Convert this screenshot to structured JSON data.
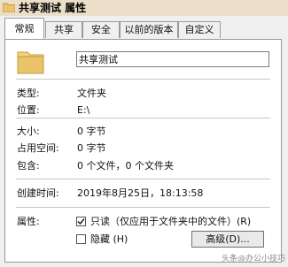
{
  "window": {
    "title": "共享测试 属性"
  },
  "tabs": [
    {
      "label": "常规",
      "active": true
    },
    {
      "label": "共享"
    },
    {
      "label": "安全"
    },
    {
      "label": "以前的版本"
    },
    {
      "label": "自定义"
    }
  ],
  "general": {
    "folder_name": "共享测试",
    "type_label": "类型:",
    "type_value": "文件夹",
    "location_label": "位置:",
    "location_value": "E:\\",
    "size_label": "大小:",
    "size_value": "0 字节",
    "disk_size_label": "占用空间:",
    "disk_size_value": "0 字节",
    "contains_label": "包含:",
    "contains_value": "0 个文件，0 个文件夹",
    "created_label": "创建时间:",
    "created_value": "2019年8月25日，18:13:58",
    "attributes_label": "属性:",
    "readonly_label": "只读（仅应用于文件夹中的文件）(R)",
    "readonly_checked": true,
    "hidden_label": "隐藏 (H)",
    "hidden_checked": false,
    "advanced_label": "高级(D)..."
  },
  "watermark": "头条@办公小技巧",
  "icons": [
    "folder-icon",
    "folder-large-icon",
    "checkmark-icon"
  ],
  "colors": {
    "titlebar": "#ecdfca",
    "folder": "#e9c46a"
  }
}
